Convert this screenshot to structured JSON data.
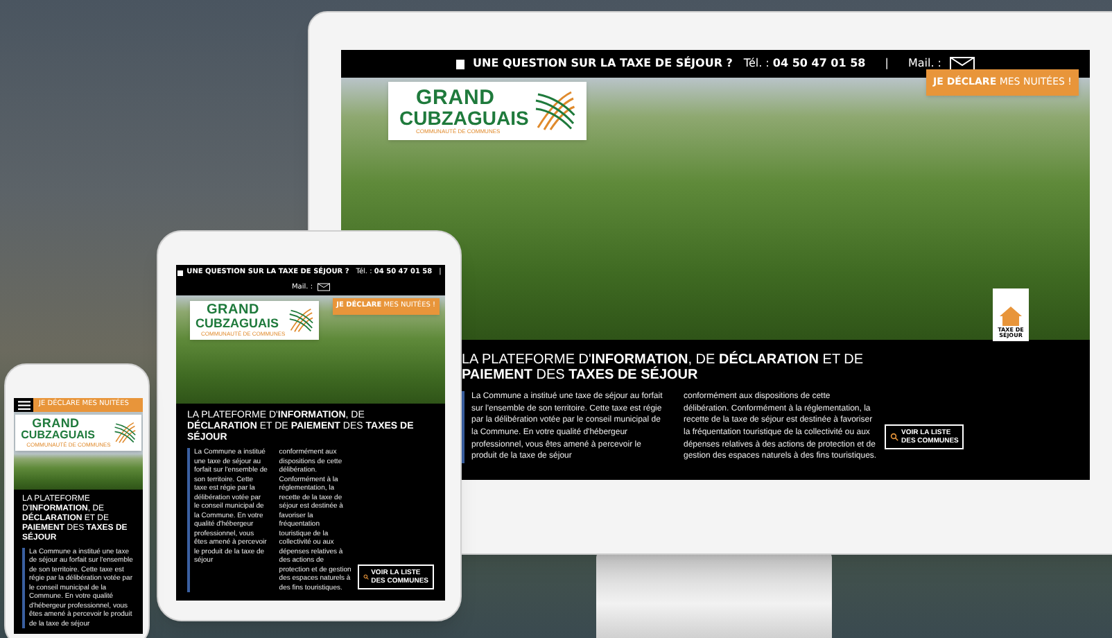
{
  "devices": [
    {
      "kind": "desktop",
      "topbar": {
        "question": "UNE QUESTION SUR LA TAXE DE SÉJOUR ?",
        "tel": "Tél. : **04 50 47 01 58**",
        "separator": "|",
        "mail_label": "Mail. :"
      },
      "declare": "**JE DÉCLARE** MES NUITÉES !",
      "logo": {
        "line1": "GRAND",
        "line2": "CUBZAGUAIS",
        "tagline": "COMMUNAUTÉ DE COMMUNES"
      },
      "tax_badge": "TAXE DE SÉJOUR",
      "headline": "LA PLATEFORME D'**INFORMATION**, DE **DÉCLARATION** ET DE **PAIEMENT** DES **TAXES DE SÉJOUR**",
      "columns": [
        "La Commune  a institué une taxe de séjour au forfait sur l'ensemble de son territoire. Cette taxe est régie par la délibération votée par le conseil municipal de la Commune. En votre qualité d'hébergeur professionnel, vous êtes amené à percevoir le produit de la taxe de séjour",
        "conformément aux dispositions de cette délibération. Conformément à la réglementation, la recette de la taxe de séjour est destinée à favoriser la fréquentation touristique de la collectivité ou aux dépenses relatives à des actions de protection et de gestion des espaces naturels à des fins touristiques."
      ],
      "list_button": [
        "VOIR LA LISTE",
        "DES COMMUNES"
      ]
    },
    {
      "kind": "tablet",
      "topbar": {
        "question": "UNE QUESTION SUR LA TAXE DE SÉJOUR ?",
        "tel": "Tél. : **04 50 47 01 58**",
        "separator": "|",
        "mail_label": "Mail. :"
      },
      "declare": "**JE DÉCLARE** MES NUITÉES !",
      "logo": {
        "line1": "GRAND",
        "line2": "CUBZAGUAIS",
        "tagline": "COMMUNAUTÉ DE COMMUNES"
      },
      "headline": "LA PLATEFORME D'**INFORMATION**, DE **DÉCLARATION** ET DE **PAIEMENT** DES **TAXES DE SÉJOUR**",
      "columns": [
        "La Commune  a institué une taxe de séjour au forfait sur l'ensemble de son territoire. Cette taxe est régie par la délibération votée par le conseil municipal de la Commune. En votre qualité d'hébergeur professionnel, vous êtes amené à percevoir le produit de la taxe de séjour",
        "conformément aux dispositions de cette délibération. Conformément à la réglementation, la recette de la taxe de séjour est destinée à favoriser la fréquentation touristique de la collectivité ou aux dépenses relatives à des actions de protection et de gestion des espaces naturels à des fins touristiques."
      ],
      "list_button": [
        "VOIR LA LISTE",
        "DES COMMUNES"
      ]
    },
    {
      "kind": "phone",
      "declare": "JE DÉCLARE MES NUITÉES",
      "logo": {
        "line1": "GRAND",
        "line2": "CUBZAGUAIS",
        "tagline": "COMMUNAUTÉ DE COMMUNES"
      },
      "headline": "LA PLATEFORME D'**INFORMATION**, DE **DÉCLARATION** ET DE **PAIEMENT** DES **TAXES DE SÉJOUR**",
      "columns": [
        "La Commune  a institué une taxe de séjour au forfait sur l'ensemble de son territoire. Cette taxe est régie par la délibération votée par le conseil municipal de la Commune. En votre qualité d'hébergeur professionnel, vous êtes amené à percevoir le produit de la taxe de séjour"
      ]
    }
  ]
}
